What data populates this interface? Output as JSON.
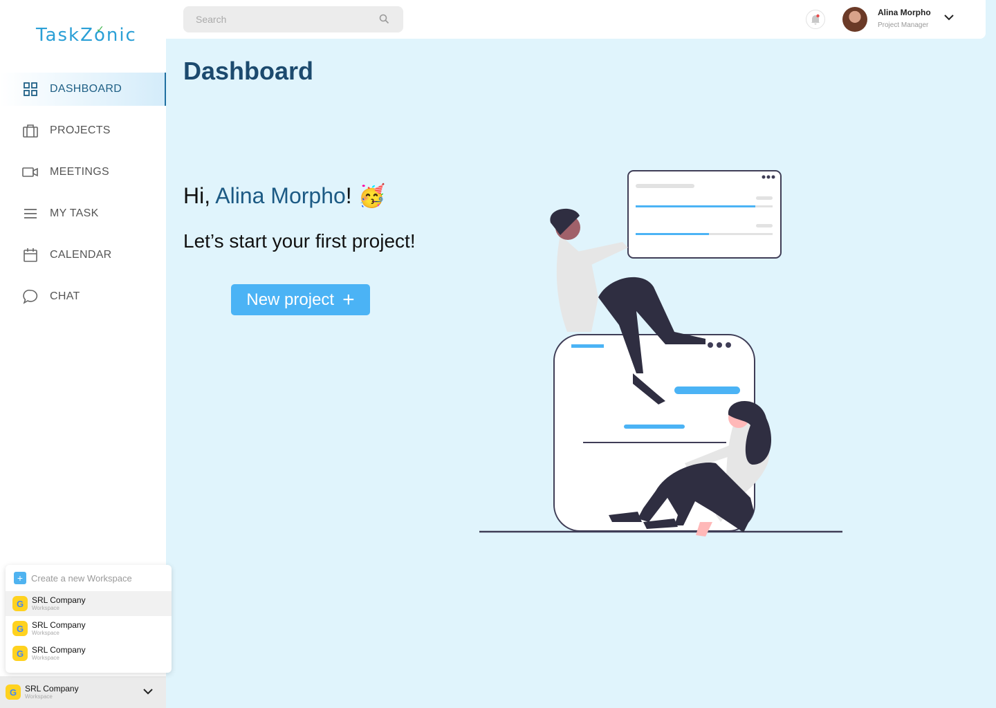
{
  "brand": {
    "name_part1": "Task",
    "name_part2": "Z",
    "name_part3": "nic"
  },
  "sidebar": {
    "items": [
      {
        "label": "DASHBOARD",
        "icon": "grid-icon",
        "active": true
      },
      {
        "label": "PROJECTS",
        "icon": "briefcase-icon",
        "active": false
      },
      {
        "label": "MEETINGS",
        "icon": "video-icon",
        "active": false
      },
      {
        "label": "MY TASK",
        "icon": "list-icon",
        "active": false
      },
      {
        "label": "CALENDAR",
        "icon": "calendar-icon",
        "active": false
      },
      {
        "label": "CHAT",
        "icon": "chat-icon",
        "active": false
      }
    ]
  },
  "workspace_menu": {
    "create_label": "Create a new Workspace",
    "items": [
      {
        "name": "SRL Company",
        "type": "Workspace"
      },
      {
        "name": "SRL Company",
        "type": "Workspace"
      },
      {
        "name": "SRL Company",
        "type": "Workspace"
      }
    ],
    "current": {
      "name": "SRL Company",
      "type": "Workspace"
    }
  },
  "topbar": {
    "search_placeholder": "Search",
    "user_name": "Alina Morpho",
    "user_role": "Project Manager"
  },
  "main": {
    "title": "Dashboard",
    "greeting_prefix": "Hi, ",
    "greeting_name": "Alina Morpho",
    "greeting_suffix": "! 🥳",
    "subheading": "Let’s start your first project!",
    "new_project_label": "New project",
    "new_project_icon": "+"
  },
  "colors": {
    "accent": "#4bb3f5",
    "title": "#1c4a6e",
    "background": "#e0f4fc"
  }
}
